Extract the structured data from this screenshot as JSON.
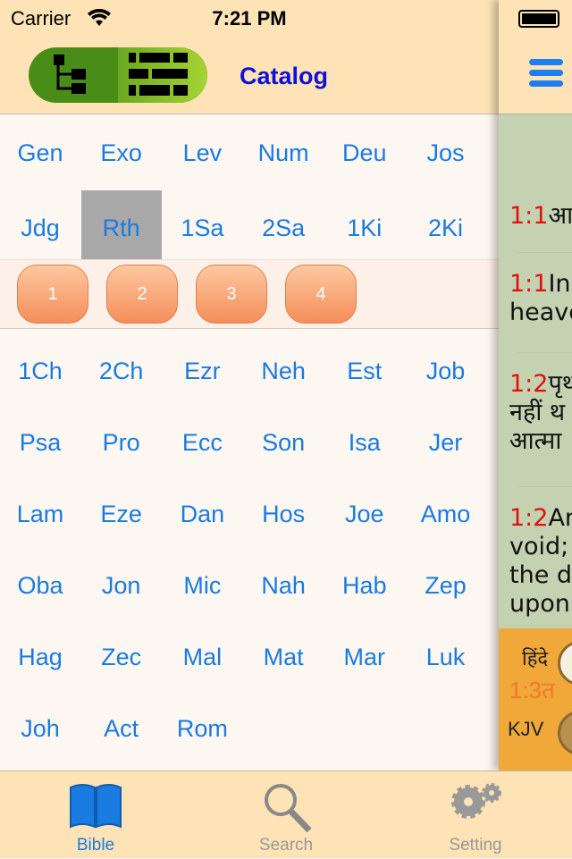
{
  "status_bar": {
    "carrier": "Carrier",
    "time": "7:21 PM"
  },
  "header": {
    "title": "Catalog",
    "view_toggle": [
      "tree-view-icon",
      "grid-view-icon"
    ]
  },
  "books_top": [
    "Gen",
    "Exo",
    "Lev",
    "Num",
    "Deu",
    "Jos",
    "Jdg",
    "Rth",
    "1Sa",
    "2Sa",
    "1Ki",
    "2Ki"
  ],
  "selected_book": "Rth",
  "chapters": [
    "1",
    "2",
    "3",
    "4"
  ],
  "books_bottom": [
    "1Ch",
    "2Ch",
    "Ezr",
    "Neh",
    "Est",
    "Job",
    "Psa",
    "Pro",
    "Ecc",
    "Son",
    "Isa",
    "Jer",
    "Lam",
    "Eze",
    "Dan",
    "Hos",
    "Joe",
    "Amo",
    "Oba",
    "Jon",
    "Mic",
    "Nah",
    "Hab",
    "Zep",
    "Hag",
    "Zec",
    "Mal",
    "Mat",
    "Mar",
    "Luk",
    "Joh",
    "Act",
    "Rom"
  ],
  "reader": {
    "verses": [
      {
        "num": "1:1",
        "lines": [
          "आ"
        ]
      },
      {
        "num": "1:1",
        "lines": [
          "In",
          "heave"
        ]
      },
      {
        "num": "1:2",
        "lines": [
          "पृथ",
          "नहीं थ",
          "आत्मा"
        ]
      },
      {
        "num": "1:2",
        "lines": [
          "An",
          "void;",
          "the d",
          "upon"
        ]
      }
    ],
    "lang_hindi": "हिंदे",
    "next_verse": "1:3त",
    "lang_kjv": "KJV"
  },
  "tabs": [
    {
      "label": "Bible",
      "icon": "book-icon"
    },
    {
      "label": "Search",
      "icon": "search-icon"
    },
    {
      "label": "Setting",
      "icon": "gears-icon"
    }
  ],
  "colors": {
    "accent": "#1a7be0",
    "title": "#1010d8",
    "verse_number": "#e01010",
    "header_bg": "#fde3b5"
  }
}
